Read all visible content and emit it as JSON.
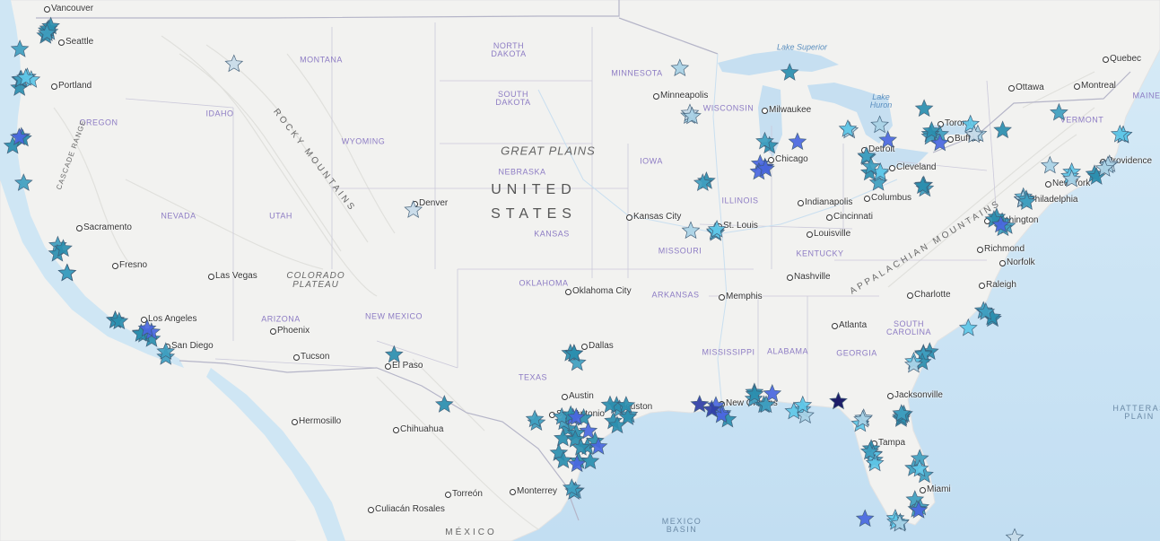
{
  "map": {
    "labels": {
      "country": "UNITED STATES",
      "country_line1": "UNITED",
      "country_line2": "STATES",
      "mexico": "MÉXICO",
      "states": [
        "MONTANA",
        "NORTH DAKOTA",
        "SOUTH DAKOTA",
        "MINNESOTA",
        "WISCONSIN",
        "IDAHO",
        "OREGON",
        "WYOMING",
        "NEBRASKA",
        "IOWA",
        "ILLINOIS",
        "NEVADA",
        "UTAH",
        "KANSAS",
        "MISSOURI",
        "KENTUCKY",
        "OKLAHOMA",
        "ARKANSAS",
        "ARIZONA",
        "NEW MEXICO",
        "TEXAS",
        "MISSISSIPPI",
        "ALABAMA",
        "GEORGIA",
        "SOUTH CAROLINA",
        "VERMONT",
        "MAINE"
      ],
      "regions": [
        "GREAT PLAINS",
        "COLORADO PLATEAU"
      ],
      "mountains": [
        "ROCKY MOUNTAINS",
        "APPALACHIAN MOUNTAINS",
        "CASCADE RANGE"
      ],
      "water": [
        "Lake Superior",
        "Lake Huron"
      ],
      "ocean": [
        "MEXICO BASIN",
        "HATTERAS PLAIN"
      ]
    },
    "cities": [
      "Vancouver",
      "Seattle",
      "Portland",
      "Sacramento",
      "Fresno",
      "Los Angeles",
      "San Diego",
      "Las Vegas",
      "Phoenix",
      "Tucson",
      "El Paso",
      "Denver",
      "Minneapolis",
      "Milwaukee",
      "Chicago",
      "Detroit",
      "Toronto",
      "Buffalo",
      "Cleveland",
      "Columbus",
      "Indianapolis",
      "Cincinnati",
      "Louisville",
      "St. Louis",
      "Kansas City",
      "Oklahoma City",
      "Dallas",
      "Austin",
      "San Antonio",
      "Houston",
      "New Orleans",
      "Memphis",
      "Nashville",
      "Atlanta",
      "Charlotte",
      "Raleigh",
      "Richmond",
      "Norfolk",
      "Washington",
      "Philadelphia",
      "New York",
      "Providence",
      "Ottawa",
      "Montreal",
      "Quebec",
      "Jacksonville",
      "Tampa",
      "Miami",
      "Hermosillo",
      "Chihuahua",
      "Torreón",
      "Culiacán Rosales",
      "Monterrey"
    ],
    "marker_style": {
      "shape": "star",
      "palette": [
        "#0b0b5e",
        "#2f3fa8",
        "#4a68e0",
        "#2b8faf",
        "#3f9fc0",
        "#5fc7e8",
        "#a9d2e6",
        "#c8dcea"
      ]
    },
    "colors": {
      "land": "#f2f2f0",
      "water": "#cfe6f4",
      "state_label": "#8d7cc4",
      "border": "#c9c9d6"
    }
  }
}
